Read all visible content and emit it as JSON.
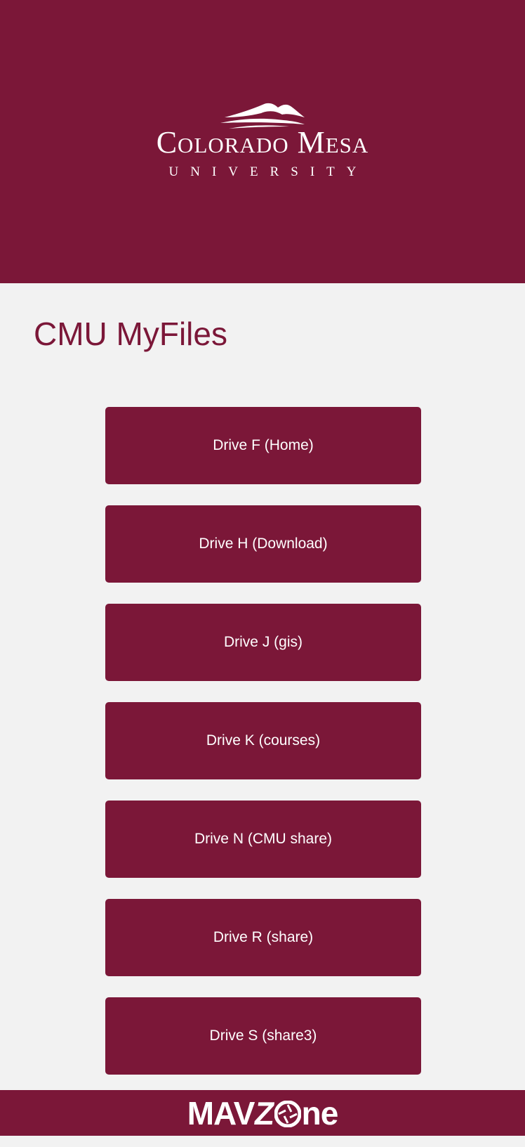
{
  "header": {
    "logo_name": "Colorado Mesa",
    "logo_sub": "UNIVERSITY",
    "background": "#7b1738"
  },
  "page": {
    "title": "CMU MyFiles"
  },
  "drives": [
    {
      "label": "Drive F (Home)"
    },
    {
      "label": "Drive H (Download)"
    },
    {
      "label": "Drive J (gis)"
    },
    {
      "label": "Drive K (courses)"
    },
    {
      "label": "Drive N (CMU share)"
    },
    {
      "label": "Drive R (share)"
    },
    {
      "label": "Drive S (share3)"
    }
  ],
  "footer": {
    "logo_text": "MAVZONE",
    "logo_part1": "MAV",
    "logo_part2": "Z",
    "logo_part3": "ne"
  },
  "colors": {
    "brand": "#7b1738",
    "page_bg": "#f2f2f2",
    "text_on_brand": "#ffffff"
  }
}
